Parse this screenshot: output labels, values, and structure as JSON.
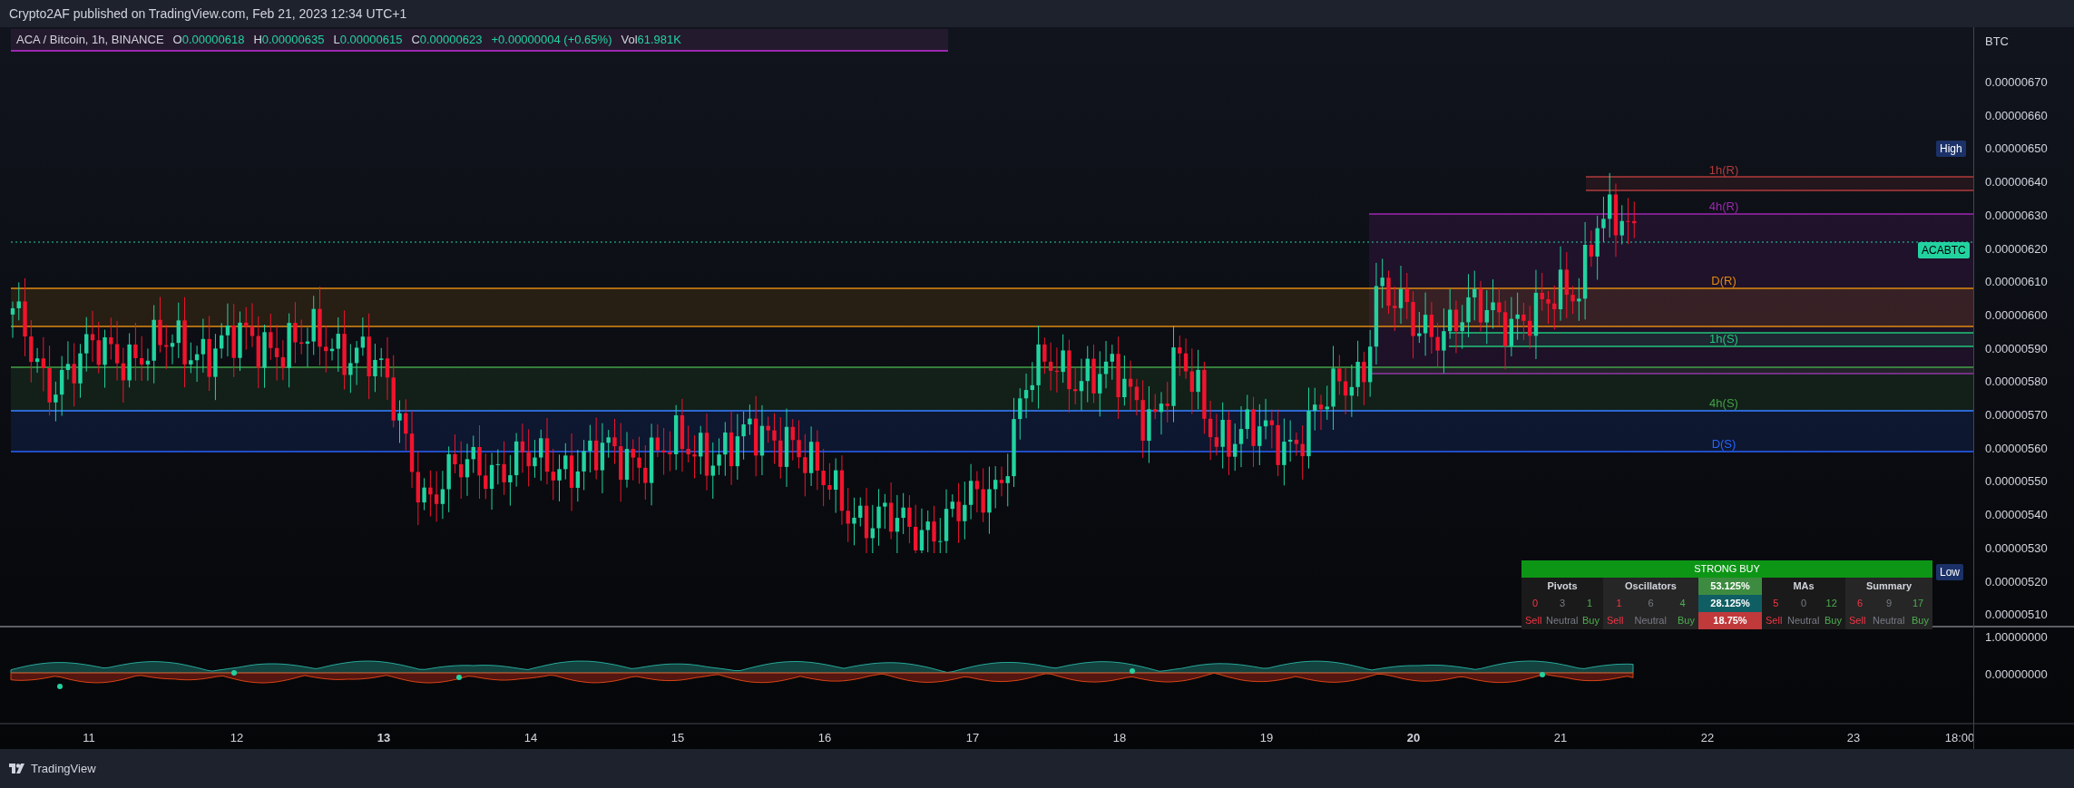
{
  "header": {
    "publisher_line": "Crypto2AF published on TradingView.com, Feb 21, 2023 12:34 UTC+1"
  },
  "legend": {
    "symbol": "ACA / Bitcoin, 1h, BINANCE",
    "fields": [
      {
        "key": "O",
        "value": "0.00000618"
      },
      {
        "key": "H",
        "value": "0.00000635"
      },
      {
        "key": "L",
        "value": "0.00000615"
      },
      {
        "key": "C",
        "value": "0.00000623"
      }
    ],
    "change": "+0.00000004 (+0.65%)",
    "volume_label": "Vol",
    "volume": "61.981K"
  },
  "price_axis": {
    "currency": "BTC",
    "ticks": [
      "0.00000670",
      "0.00000660",
      "0.00000650",
      "0.00000640",
      "0.00000630",
      "0.00000620",
      "0.00000610",
      "0.00000600",
      "0.00000590",
      "0.00000580",
      "0.00000570",
      "0.00000560",
      "0.00000550",
      "0.00000540",
      "0.00000530",
      "0.00000520",
      "0.00000510"
    ]
  },
  "price_badges": [
    {
      "label": "High",
      "kind": "high"
    },
    {
      "label": "ACABTC",
      "kind": "last"
    },
    {
      "label": "Low",
      "kind": "low"
    }
  ],
  "zones": [
    {
      "label": "1h(R)",
      "color": "#b23b3b"
    },
    {
      "label": "4h(R)",
      "color": "#9c27b0"
    },
    {
      "label": "D(R)",
      "color": "#e08a10"
    },
    {
      "label": "1h(S)",
      "color": "#22c47a"
    },
    {
      "label": "4h(S)",
      "color": "#43a047"
    },
    {
      "label": "D(S)",
      "color": "#2962ff"
    }
  ],
  "rating_table": {
    "title": "STRONG BUY",
    "groups": [
      {
        "name": "Pivots",
        "sell": "0",
        "neutral": "3",
        "buy": "1",
        "sell_label": "Sell",
        "neutral_label": "Neutral",
        "buy_label": "Buy"
      },
      {
        "name": "Oscillators",
        "sell": "1",
        "neutral": "6",
        "buy": "4",
        "sell_label": "Sell",
        "neutral_label": "Neutral",
        "buy_label": "Buy"
      },
      {
        "name": "MAs",
        "sell": "5",
        "neutral": "0",
        "buy": "12",
        "sell_label": "Sell",
        "neutral_label": "Neutral",
        "buy_label": "Buy"
      },
      {
        "name": "Summary",
        "sell": "6",
        "neutral": "9",
        "buy": "17",
        "sell_label": "Sell",
        "neutral_label": "Neutral",
        "buy_label": "Buy"
      }
    ],
    "percentages": [
      {
        "value": "53.125%",
        "kind": "buy"
      },
      {
        "value": "28.125%",
        "kind": "neutral"
      },
      {
        "value": "18.75%",
        "kind": "sell"
      }
    ]
  },
  "indicator_axis": {
    "ticks": [
      "1.00000000",
      "0.00000000"
    ]
  },
  "time_axis": {
    "labels": [
      {
        "text": "11",
        "bold": false
      },
      {
        "text": "12",
        "bold": false
      },
      {
        "text": "13",
        "bold": true
      },
      {
        "text": "14",
        "bold": false
      },
      {
        "text": "15",
        "bold": false
      },
      {
        "text": "16",
        "bold": false
      },
      {
        "text": "17",
        "bold": false
      },
      {
        "text": "18",
        "bold": false
      },
      {
        "text": "19",
        "bold": false
      },
      {
        "text": "20",
        "bold": true
      },
      {
        "text": "21",
        "bold": false
      },
      {
        "text": "22",
        "bold": false
      },
      {
        "text": "23",
        "bold": false
      },
      {
        "text": "18:00",
        "bold": false
      }
    ]
  },
  "footer": {
    "brand": "TradingView"
  }
}
